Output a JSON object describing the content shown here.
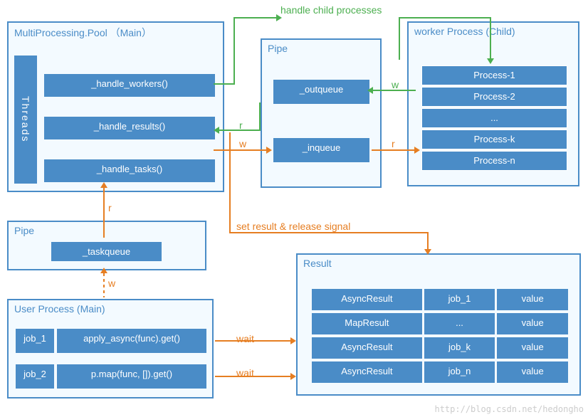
{
  "labels": {
    "handle_child": "handle child processes",
    "set_result": "set result & release signal",
    "wait1": "wait",
    "wait2": "wait",
    "r1": "r",
    "r2": "r",
    "r3": "r",
    "w1": "w",
    "w2": "w",
    "w3": "w"
  },
  "mpool": {
    "title": "MultiProcessing.Pool （Main）",
    "threads_label": "Threads",
    "handle_workers": "_handle_workers()",
    "handle_results": "_handle_results()",
    "handle_tasks": "_handle_tasks()"
  },
  "pipe_top": {
    "title": "Pipe",
    "outqueue": "_outqueue",
    "inqueue": "_inqueue"
  },
  "worker": {
    "title": "worker Process (Child)",
    "rows": [
      "Process-1",
      "Process-2",
      "...",
      "Process-k",
      "Process-n"
    ]
  },
  "pipe_left": {
    "title": "Pipe",
    "taskqueue": "_taskqueue"
  },
  "userproc": {
    "title": "User Process (Main)",
    "job1_id": "job_1",
    "job1_call": "apply_async(func).get()",
    "job2_id": "job_2",
    "job2_call": "p.map(func, []).get()"
  },
  "result": {
    "title": "Result",
    "rows": [
      {
        "type": "AsyncResult",
        "job": "job_1",
        "val": "value"
      },
      {
        "type": "MapResult",
        "job": "...",
        "val": "value"
      },
      {
        "type": "AsyncResult",
        "job": "job_k",
        "val": "value"
      },
      {
        "type": "AsyncResult",
        "job": "job_n",
        "val": "value"
      }
    ]
  },
  "watermark": "http://blog.csdn.net/hedongho"
}
